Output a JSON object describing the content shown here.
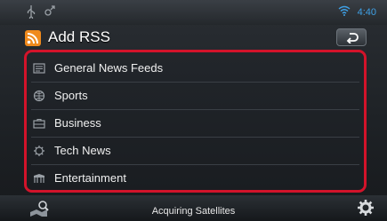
{
  "statusbar": {
    "time": "4:40"
  },
  "header": {
    "title": "Add RSS"
  },
  "feeds": [
    {
      "label": "General News Feeds",
      "icon": "newspaper-icon"
    },
    {
      "label": "Sports",
      "icon": "ball-icon"
    },
    {
      "label": "Business",
      "icon": "briefcase-icon"
    },
    {
      "label": "Tech News",
      "icon": "tech-icon"
    },
    {
      "label": "Entertainment",
      "icon": "film-icon"
    }
  ],
  "footer": {
    "status": "Acquiring Satellites"
  },
  "colors": {
    "highlight": "#d3132a",
    "accent": "#3ea0e6",
    "rss": "#f08a1c"
  }
}
